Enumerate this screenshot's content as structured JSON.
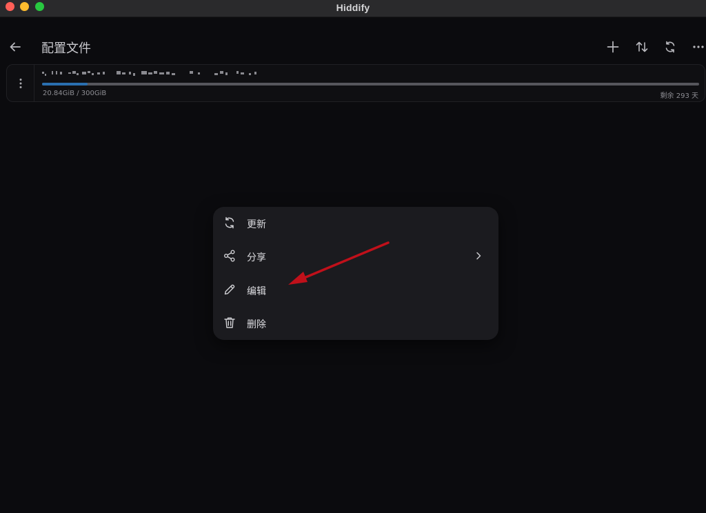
{
  "window": {
    "title": "Hiddify"
  },
  "appbar": {
    "title": "配置文件",
    "actions": [
      "add-icon",
      "sort-icon",
      "refresh-icon",
      "more-icon"
    ]
  },
  "profile": {
    "usage": "20.84GiB / 300GiB",
    "remaining": "剩余 293 天",
    "progress_fraction": 0.0695,
    "progress_color": "#2a6fb0"
  },
  "context_menu": {
    "items": [
      {
        "label": "更新",
        "icon": "refresh-icon"
      },
      {
        "label": "分享",
        "icon": "share-icon",
        "has_submenu": true
      },
      {
        "label": "编辑",
        "icon": "pencil-icon"
      },
      {
        "label": "删除",
        "icon": "trash-icon"
      }
    ]
  },
  "annotation": {
    "arrow_color": "#c0101a",
    "target": "编辑"
  }
}
